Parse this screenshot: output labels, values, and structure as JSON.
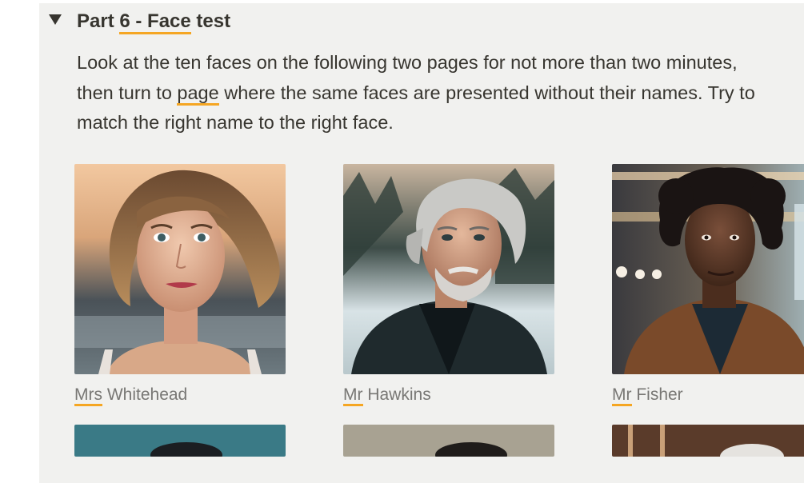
{
  "section": {
    "heading_prefix": "Part ",
    "heading_underlined": "6 - Face",
    "heading_suffix": " test",
    "description": {
      "line1": "Look at the ten faces on the following two pages for not more than two minutes,",
      "line2_a": "then turn to ",
      "line2_link": "page",
      "line2_b": " where the same faces are presented without their names. Try to",
      "line3": "match the right name to the right face."
    }
  },
  "faces": [
    {
      "title": "Mrs",
      "surname": " Whitehead"
    },
    {
      "title": "Mr",
      "surname": " Hawkins"
    },
    {
      "title": "Mr",
      "surname": " Fisher"
    }
  ],
  "colors": {
    "panel_bg": "#f1f1ef",
    "text": "#37352f",
    "caption": "#787774",
    "spell_underline": "#f5a623"
  },
  "icons": {
    "toggle": "triangle-down-icon"
  }
}
